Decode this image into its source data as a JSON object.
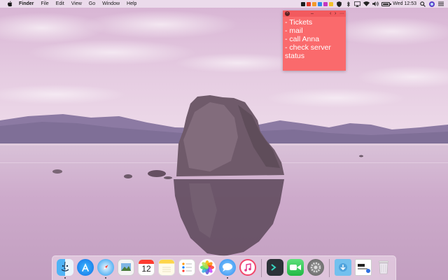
{
  "menubar": {
    "apple_icon": "apple-logo-icon",
    "items": [
      "Finder",
      "File",
      "Edit",
      "View",
      "Go",
      "Window",
      "Help"
    ],
    "status_colors": [
      "#1d1d1d",
      "#e23b2e",
      "#f39a2b",
      "#2f8be8",
      "#c337c2",
      "#f2c029"
    ],
    "clock": "Wed 12:53"
  },
  "sticky_note": {
    "color": "#fa6a6c",
    "text": "- Tickets\n- mail\n- call Anna\n- check server status"
  },
  "dock": {
    "items": [
      {
        "name": "finder-icon",
        "running": true
      },
      {
        "name": "app-store-icon",
        "running": false
      },
      {
        "name": "safari-icon",
        "running": true
      },
      {
        "name": "preview-icon",
        "running": false
      },
      {
        "name": "calendar-icon",
        "running": false,
        "label": "12"
      },
      {
        "name": "notes-icon",
        "running": false
      },
      {
        "name": "reminders-icon",
        "running": false
      },
      {
        "name": "photos-icon",
        "running": false
      },
      {
        "name": "messages-icon",
        "running": true
      },
      {
        "name": "itunes-icon",
        "running": false
      },
      {
        "name": "terminal-icon",
        "running": false
      },
      {
        "name": "facetime-icon",
        "running": false
      },
      {
        "name": "system-preferences-icon",
        "running": false
      },
      {
        "name": "downloads-folder-icon",
        "running": false
      },
      {
        "name": "documents-stack-icon",
        "running": false
      },
      {
        "name": "trash-icon",
        "running": false
      }
    ]
  }
}
